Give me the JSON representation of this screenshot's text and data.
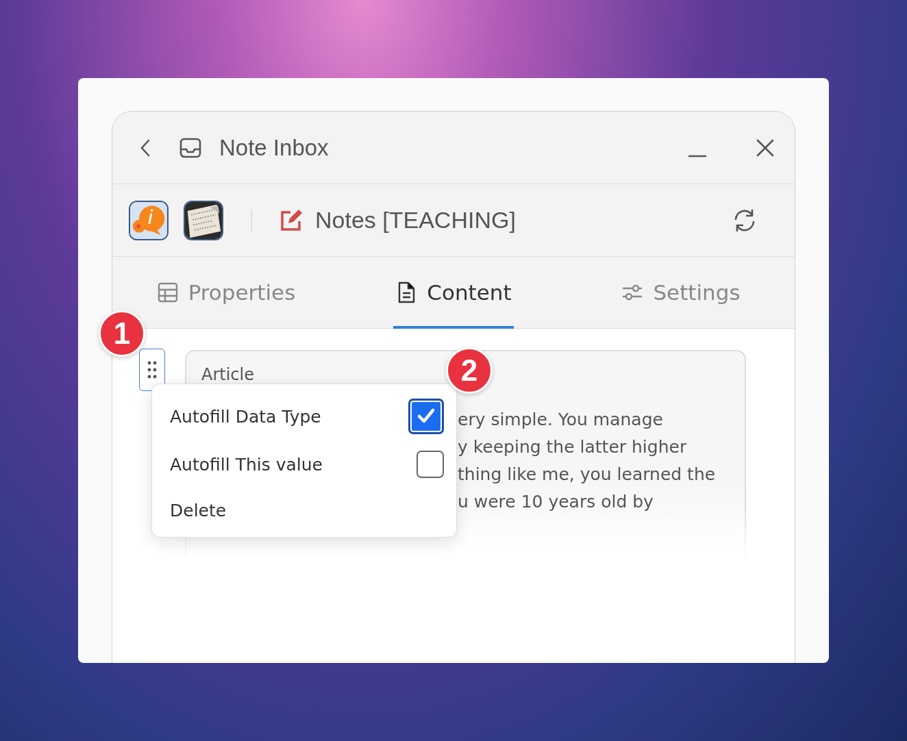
{
  "window": {
    "title": "Note Inbox"
  },
  "toolbar": {
    "note_title": "Notes [TEACHING]"
  },
  "tabs": [
    {
      "label": "Properties",
      "selected": false
    },
    {
      "label": "Content",
      "selected": true
    },
    {
      "label": "Settings",
      "selected": false
    }
  ],
  "article": {
    "title": "Article",
    "lines": [
      "ery simple. You manage",
      "y keeping the latter higher",
      "thing like me, you learned the",
      "u were 10 years old by"
    ]
  },
  "menu": {
    "items": [
      {
        "label": "Autofill Data Type",
        "kind": "checkbox",
        "checked": true
      },
      {
        "label": "Autofill This value",
        "kind": "checkbox",
        "checked": false
      },
      {
        "label": "Delete",
        "kind": "action"
      }
    ]
  },
  "callouts": [
    "1",
    "2"
  ]
}
